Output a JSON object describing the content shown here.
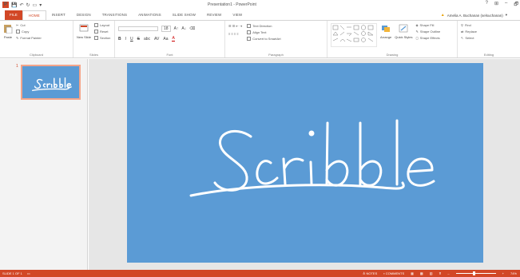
{
  "titlebar": {
    "title": "Presentation1 - PowerPoint",
    "logo": "P",
    "controls": [
      "?",
      "⊞",
      "–",
      "🗗"
    ]
  },
  "tabs": [
    {
      "label": "FILE",
      "kind": "file"
    },
    {
      "label": "HOME",
      "kind": "active"
    },
    {
      "label": "INSERT",
      "kind": ""
    },
    {
      "label": "DESIGN",
      "kind": ""
    },
    {
      "label": "TRANSITIONS",
      "kind": ""
    },
    {
      "label": "ANIMATIONS",
      "kind": ""
    },
    {
      "label": "SLIDE SHOW",
      "kind": ""
    },
    {
      "label": "REVIEW",
      "kind": ""
    },
    {
      "label": "VIEW",
      "kind": ""
    }
  ],
  "user": {
    "name": "Amelia A. Buchanan (selsuchanan)",
    "warning_icon": "warning-icon"
  },
  "ribbon": {
    "clipboard": {
      "label": "Clipboard",
      "paste": "Paste",
      "cut": "Cut",
      "copy": "Copy",
      "format_painter": "Format Painter"
    },
    "slides": {
      "label": "Slides",
      "new_slide": "New Slide",
      "layout": "Layout",
      "reset": "Reset",
      "section": "Section"
    },
    "font": {
      "label": "Font",
      "size": "18",
      "bold": "B",
      "italic": "I",
      "underline": "U",
      "strike": "S",
      "shadow": "abc",
      "spacing": "AV",
      "case": "Aa",
      "color": "A"
    },
    "paragraph": {
      "label": "Paragraph",
      "text_direction": "Text Direction",
      "align_text": "Align Text",
      "smartart": "Convert to SmartArt"
    },
    "drawing": {
      "label": "Drawing",
      "arrange": "Arrange",
      "quick_styles": "Quick Styles",
      "shape_fill": "Shape Fill",
      "shape_outline": "Shape Outline",
      "shape_effects": "Shape Effects"
    },
    "editing": {
      "label": "Editing",
      "find": "Find",
      "replace": "Replace",
      "select": "Select"
    }
  },
  "slides_panel": {
    "slide_number": "1"
  },
  "statusbar": {
    "slide_info": "SLIDE 1 OF 1",
    "notes": "NOTES",
    "comments": "COMMENTS",
    "zoom": "74%",
    "zoom_fraction": 0.45
  },
  "colors": {
    "accent": "#d24726",
    "slide_bg": "#5b9bd5",
    "thumb_border": "#f4a58a"
  }
}
